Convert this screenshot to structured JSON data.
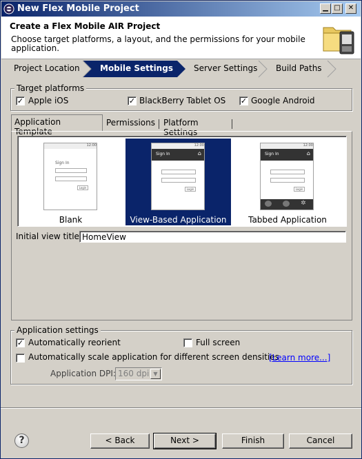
{
  "window": {
    "title": "New Flex Mobile Project"
  },
  "header": {
    "title": "Create a Flex Mobile AIR Project",
    "description": "Choose target platforms, a layout, and the permissions for your mobile application."
  },
  "steps": [
    {
      "label": "Project Location"
    },
    {
      "label": "Mobile Settings"
    },
    {
      "label": "Server Settings"
    },
    {
      "label": "Build Paths"
    }
  ],
  "target_platforms": {
    "legend": "Target platforms",
    "items": [
      {
        "label": "Apple iOS",
        "checked": true
      },
      {
        "label": "BlackBerry Tablet OS",
        "checked": true
      },
      {
        "label": "Google Android",
        "checked": true
      }
    ]
  },
  "tabs": [
    {
      "label": "Application Template"
    },
    {
      "label": "Permissions"
    },
    {
      "label": "Platform Settings"
    }
  ],
  "templates": [
    {
      "label": "Blank"
    },
    {
      "label": "View-Based Application"
    },
    {
      "label": "Tabbed Application"
    }
  ],
  "phone_preview": {
    "status": "12:00",
    "header": "Sign In",
    "blank_text": "Sign In",
    "button": "Login"
  },
  "initial_view": {
    "label": "Initial view title:",
    "value": "HomeView"
  },
  "app_settings": {
    "legend": "Application settings",
    "auto_reorient": {
      "label": "Automatically reorient",
      "checked": true
    },
    "full_screen": {
      "label": "Full screen",
      "checked": false
    },
    "auto_scale": {
      "label": "Automatically scale application for different screen densities",
      "checked": false
    },
    "learn_more": "[Learn more...]",
    "dpi_label": "Application DPI:",
    "dpi_value": "160 dpi"
  },
  "buttons": {
    "help": "?",
    "back": "< Back",
    "next": "Next >",
    "finish": "Finish",
    "cancel": "Cancel"
  },
  "colors": {
    "accent": "#0a246a",
    "face": "#d4d0c8"
  }
}
